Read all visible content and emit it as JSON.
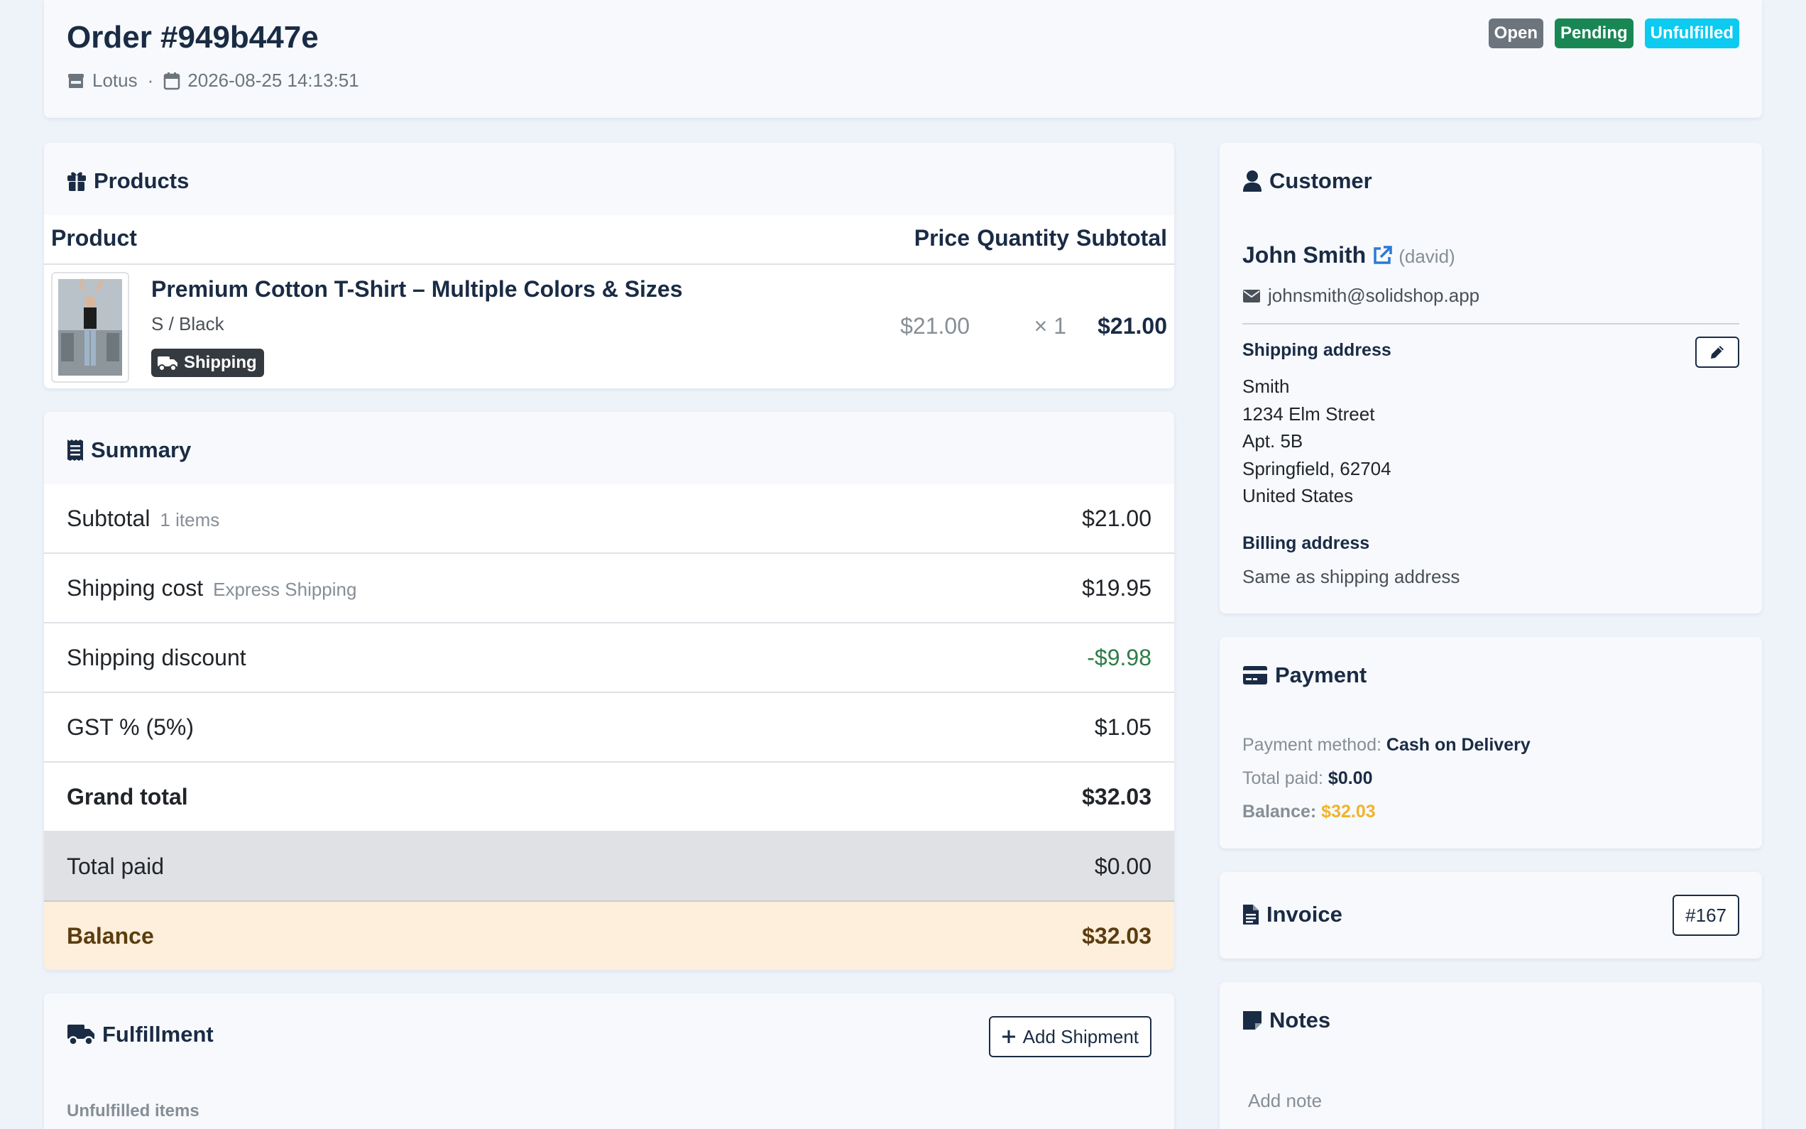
{
  "order": {
    "title": "Order #949b447e",
    "store": "Lotus",
    "separator": "·",
    "datetime": "2026-08-25 14:13:51",
    "badges": [
      {
        "label": "Open",
        "color": "#6c757d"
      },
      {
        "label": "Pending",
        "color": "#198754"
      },
      {
        "label": "Unfulfilled",
        "color": "#0dcaf0"
      }
    ]
  },
  "products": {
    "heading": "Products",
    "columns": {
      "product": "Product",
      "price": "Price",
      "quantity": "Quantity",
      "subtotal": "Subtotal"
    },
    "items": [
      {
        "name": "Premium Cotton T-Shirt – Multiple Colors & Sizes",
        "variant": "S / Black",
        "tag": "Shipping",
        "price": "$21.00",
        "quantity": "× 1",
        "subtotal": "$21.00"
      }
    ]
  },
  "summary": {
    "heading": "Summary",
    "rows": [
      {
        "label": "Subtotal",
        "hint": "1 items",
        "value": "$21.00"
      },
      {
        "label": "Shipping cost",
        "hint": "Express Shipping",
        "value": "$19.95"
      },
      {
        "label": "Shipping discount",
        "hint": "",
        "value": "-$9.98"
      },
      {
        "label": "GST % (5%)",
        "hint": "",
        "value": "$1.05"
      },
      {
        "label": "Grand total",
        "hint": "",
        "value": "$32.03"
      },
      {
        "label": "Total paid",
        "hint": "",
        "value": "$0.00"
      },
      {
        "label": "Balance",
        "hint": "",
        "value": "$32.03"
      }
    ],
    "colors": {
      "discount": "#2f7d4a",
      "paid_bg": "#dfe1e4",
      "balance_bg": "#fdefdb",
      "balance_text": "#5b3d10"
    }
  },
  "fulfillment": {
    "heading": "Fulfillment",
    "add_button": "Add Shipment",
    "unfulfilled_label": "Unfulfilled items"
  },
  "customer": {
    "heading": "Customer",
    "name": "John Smith",
    "username": "(david)",
    "email": "johnsmith@solidshop.app",
    "shipping_heading": "Shipping address",
    "address_lines": [
      "Smith",
      "1234 Elm Street",
      "Apt. 5B",
      "Springfield, 62704",
      "United States"
    ],
    "billing_heading": "Billing address",
    "billing_text": "Same as shipping address"
  },
  "payment": {
    "heading": "Payment",
    "method_label": "Payment method:",
    "method_value": "Cash on Delivery",
    "paid_label": "Total paid:",
    "paid_value": "$0.00",
    "balance_label": "Balance:",
    "balance_value": "$32.03",
    "balance_color": "#f0b32a"
  },
  "invoice": {
    "heading": "Invoice",
    "number": "#167"
  },
  "notes": {
    "heading": "Notes",
    "placeholder": "Add note"
  },
  "icons": {
    "store": "store-icon",
    "calendar": "calendar-icon",
    "products": "gift-box-icon",
    "truck": "truck-icon",
    "summary": "receipt-icon",
    "customer": "user-icon",
    "external": "external-link-icon",
    "email": "envelope-icon",
    "edit": "pencil-icon",
    "payment": "credit-card-icon",
    "invoice": "file-text-icon",
    "notes": "sticky-note-icon",
    "plus": "plus-icon"
  }
}
